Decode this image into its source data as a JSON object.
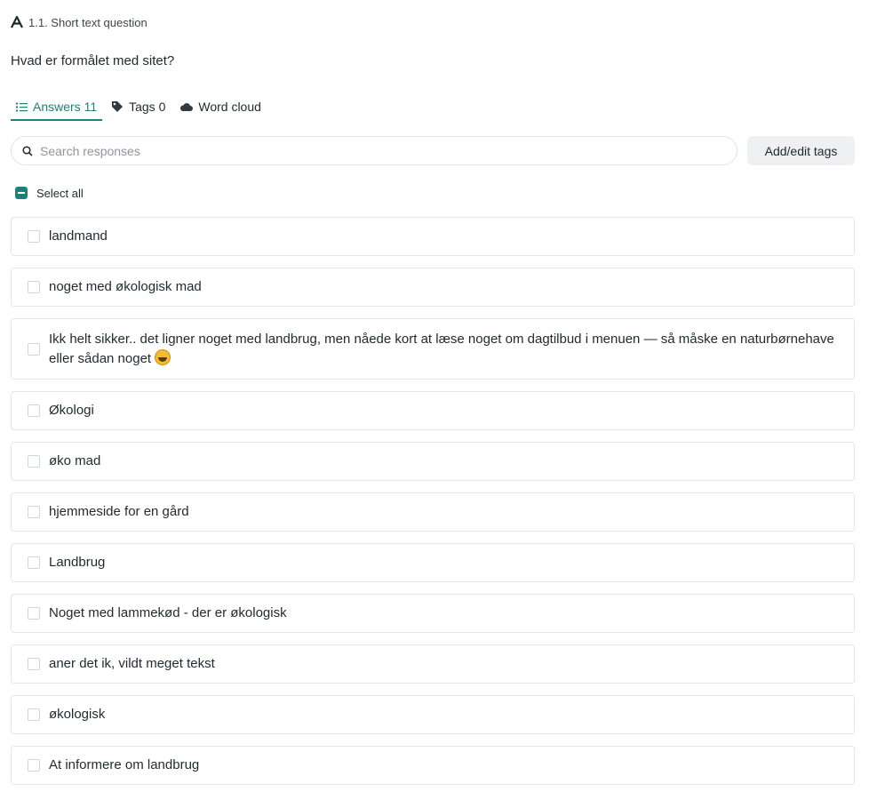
{
  "question": {
    "label": "1.1. Short text question",
    "text": "Hvad er formålet med sitet?"
  },
  "tabs": [
    {
      "label": "Answers 11",
      "icon": "list-icon",
      "active": true
    },
    {
      "label": "Tags 0",
      "icon": "tag-icon",
      "active": false
    },
    {
      "label": "Word cloud",
      "icon": "cloud-icon",
      "active": false
    }
  ],
  "search": {
    "placeholder": "Search responses",
    "value": ""
  },
  "toolbar": {
    "tags_button": "Add/edit tags"
  },
  "select_all": {
    "label": "Select all",
    "state": "indeterminate"
  },
  "answers": [
    {
      "text": "landmand"
    },
    {
      "text": "noget med økologisk mad"
    },
    {
      "text": "Ikk helt sikker.. det ligner noget med landbrug, men nåede kort at læse noget om dagtilbud i menuen — så måske en naturbørnehave eller sådan noget",
      "emoji": "grinning-sweat-emoji"
    },
    {
      "text": "Økologi"
    },
    {
      "text": "øko mad"
    },
    {
      "text": "hjemmeside for en gård"
    },
    {
      "text": "Landbrug"
    },
    {
      "text": "Noget med lammekød - der er økologisk"
    },
    {
      "text": "aner det ik, vildt meget tekst"
    },
    {
      "text": "økologisk"
    },
    {
      "text": "At informere om landbrug"
    }
  ],
  "colors": {
    "accent": "#1a8278",
    "border": "#e3e6e8",
    "button_bg": "#eef0f1"
  }
}
